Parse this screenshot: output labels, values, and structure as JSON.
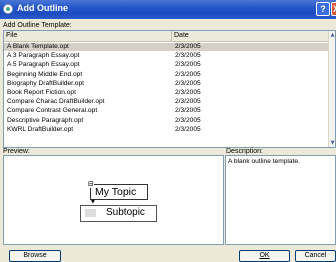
{
  "window": {
    "title": "Add Outline",
    "help_label": "?",
    "close_label": "X"
  },
  "template_section_label": "Add Outline Template:",
  "columns": {
    "file": "File",
    "date": "Date"
  },
  "templates": [
    {
      "file": "A Blank Template.opt",
      "date": "2/3/2005",
      "selected": true
    },
    {
      "file": "A 3 Paragraph Essay.opt",
      "date": "2/3/2005"
    },
    {
      "file": "A 5 Paragraph Essay.opt",
      "date": "2/3/2005"
    },
    {
      "file": "Beginning Middle End.opt",
      "date": "2/3/2005"
    },
    {
      "file": "Biography DraftBuilder.opt",
      "date": "2/3/2005"
    },
    {
      "file": "Book Report Fiction.opt",
      "date": "2/3/2005"
    },
    {
      "file": "Compare Charac DraftBuilder.opt",
      "date": "2/3/2005"
    },
    {
      "file": "Compare Contrast General.opt",
      "date": "2/3/2005"
    },
    {
      "file": "Descriptive Paragraph.opt",
      "date": "2/3/2005"
    },
    {
      "file": "KWRL DraftBuilder.opt",
      "date": "2/3/2005"
    }
  ],
  "preview": {
    "label": "Preview:",
    "topic": "My Topic",
    "collapse_glyph": "⊟",
    "subtopic": "Subtopic"
  },
  "description": {
    "label": "Description:",
    "text": "A blank outline template."
  },
  "buttons": {
    "browse": "Browse",
    "ok": "OK",
    "cancel": "Cancel"
  },
  "scroll": {
    "up": "▲",
    "down": "▼"
  }
}
